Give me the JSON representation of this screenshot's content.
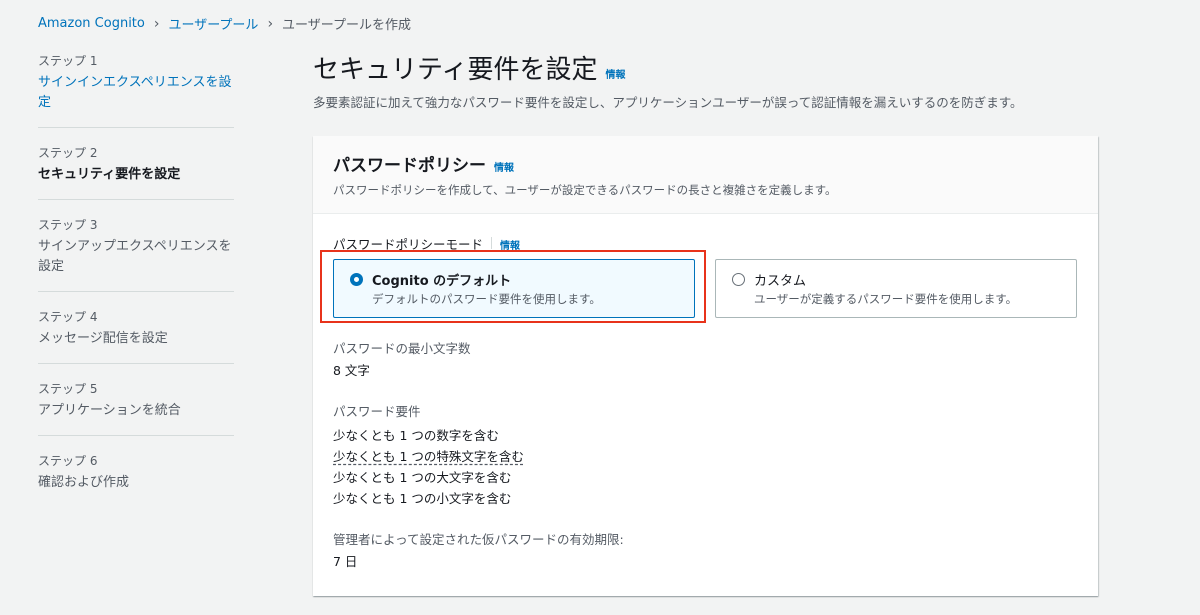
{
  "breadcrumb": {
    "items": [
      "Amazon Cognito",
      "ユーザープール"
    ],
    "current": "ユーザープールを作成"
  },
  "sidebar": {
    "steps": [
      {
        "no": "ステップ 1",
        "title": "サインインエクスペリエンスを設定"
      },
      {
        "no": "ステップ 2",
        "title": "セキュリティ要件を設定"
      },
      {
        "no": "ステップ 3",
        "title": "サインアップエクスペリエンスを設定"
      },
      {
        "no": "ステップ 4",
        "title": "メッセージ配信を設定"
      },
      {
        "no": "ステップ 5",
        "title": "アプリケーションを統合"
      },
      {
        "no": "ステップ 6",
        "title": "確認および作成"
      }
    ]
  },
  "page": {
    "title": "セキュリティ要件を設定",
    "info": "情報",
    "description": "多要素認証に加えて強力なパスワード要件を設定し、アプリケーションユーザーが誤って認証情報を漏えいするのを防ぎます。"
  },
  "panel": {
    "title": "パスワードポリシー",
    "info": "情報",
    "description": "パスワードポリシーを作成して、ユーザーが設定できるパスワードの長さと複雑さを定義します。",
    "mode_label": "パスワードポリシーモード",
    "mode_info": "情報",
    "options": [
      {
        "label": "Cognito のデフォルト",
        "desc": "デフォルトのパスワード要件を使用します。",
        "selected": true
      },
      {
        "label": "カスタム",
        "desc": "ユーザーが定義するパスワード要件を使用します。",
        "selected": false
      }
    ],
    "min_length_label": "パスワードの最小文字数",
    "min_length_value": "8 文字",
    "requirements_label": "パスワード要件",
    "requirements": [
      "少なくとも 1 つの数字を含む",
      "少なくとも 1 つの特殊文字を含む",
      "少なくとも 1 つの大文字を含む",
      "少なくとも 1 つの小文字を含む"
    ],
    "temp_expiry_label": "管理者によって設定された仮パスワードの有効期限:",
    "temp_expiry_value": "7 日"
  },
  "colors": {
    "link": "#0073bb",
    "highlight": "#e8331b",
    "selected_bg": "#f1faff"
  }
}
